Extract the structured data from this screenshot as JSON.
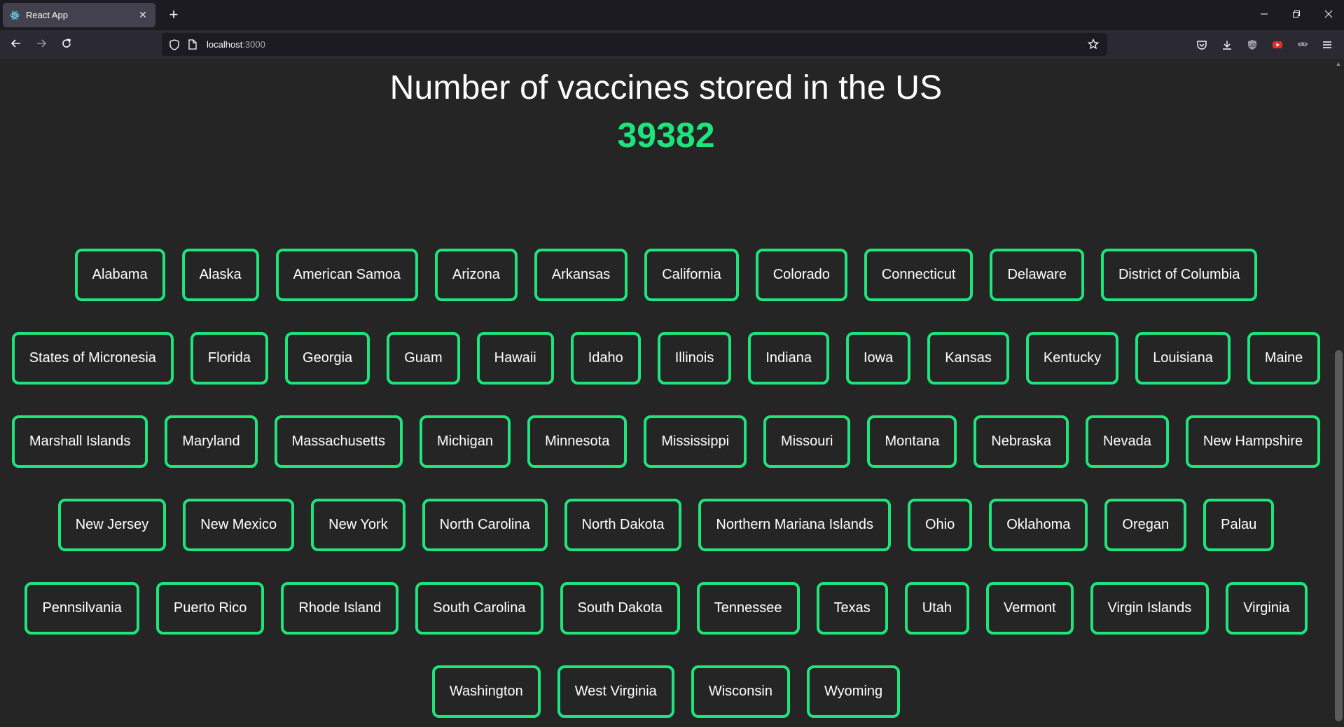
{
  "browser": {
    "tab_title": "React App",
    "tab_close": "✕",
    "new_tab": "+",
    "url_host": "localhost",
    "url_port": ":3000"
  },
  "main": {
    "heading": "Number of vaccines stored in the US",
    "count": "39382",
    "accent_color": "#1de57b",
    "rows": [
      [
        "Alabama",
        "Alaska",
        "American Samoa",
        "Arizona",
        "Arkansas",
        "California",
        "Colorado",
        "Connecticut",
        "Delaware",
        "District of Columbia"
      ],
      [
        "States of Micronesia",
        "Florida",
        "Georgia",
        "Guam",
        "Hawaii",
        "Idaho",
        "Illinois",
        "Indiana",
        "Iowa",
        "Kansas",
        "Kentucky",
        "Louisiana",
        "Maine"
      ],
      [
        "Marshall Islands",
        "Maryland",
        "Massachusetts",
        "Michigan",
        "Minnesota",
        "Mississippi",
        "Missouri",
        "Montana",
        "Nebraska",
        "Nevada",
        "New Hampshire"
      ],
      [
        "New Jersey",
        "New Mexico",
        "New York",
        "North Carolina",
        "North Dakota",
        "Northern Mariana Islands",
        "Ohio",
        "Oklahoma",
        "Oregan",
        "Palau"
      ],
      [
        "Pennsilvania",
        "Puerto Rico",
        "Rhode Island",
        "South Carolina",
        "South Dakota",
        "Tennessee",
        "Texas",
        "Utah",
        "Vermont",
        "Virgin Islands",
        "Virginia"
      ],
      [
        "Washington",
        "West Virginia",
        "Wisconsin",
        "Wyoming"
      ]
    ]
  }
}
